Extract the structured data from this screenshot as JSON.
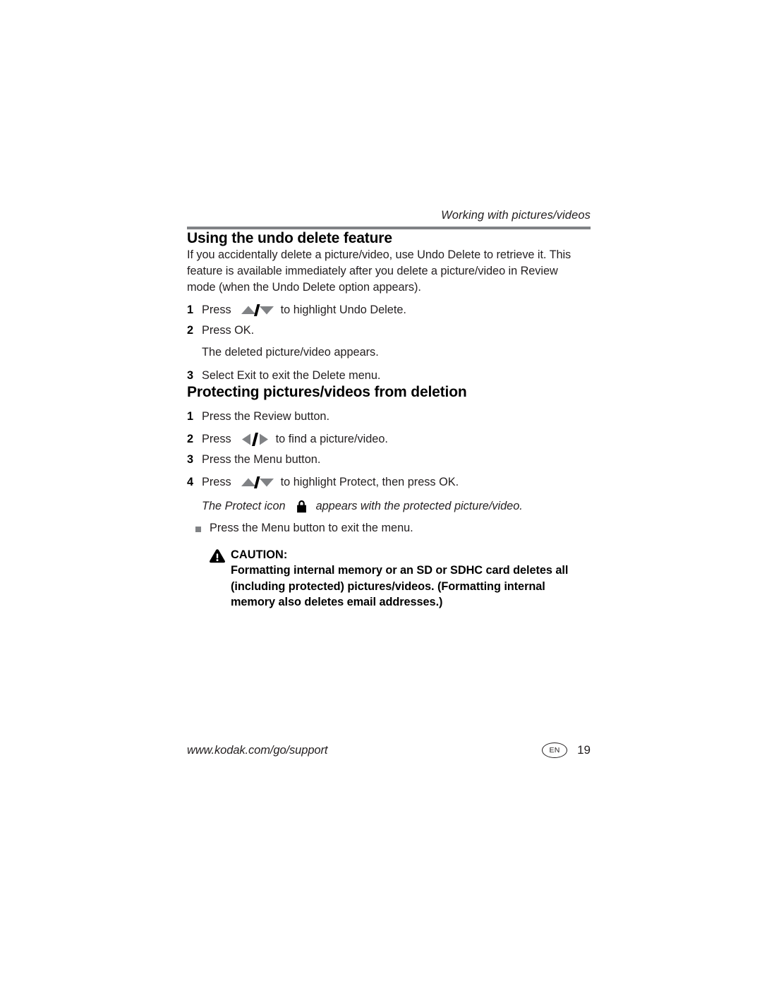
{
  "header": {
    "running_title": "Working with pictures/videos"
  },
  "sections": [
    {
      "heading": "Using the undo delete feature",
      "intro": "If you accidentally delete a picture/video, use Undo Delete to retrieve it. This feature is available immediately after you delete a picture/video in Review mode (when the Undo Delete option appears).",
      "steps": [
        {
          "num": "1",
          "pre": "Press",
          "icon": "up-down-arrows-icon",
          "post": "to highlight Undo Delete."
        },
        {
          "num": "2",
          "pre": "Press OK.",
          "icon": "",
          "post": ""
        },
        {
          "num": "",
          "note": "The deleted picture/video appears."
        },
        {
          "num": "3",
          "pre": "Select Exit to exit the Delete menu.",
          "icon": "",
          "post": ""
        }
      ]
    },
    {
      "heading": "Protecting pictures/videos from deletion",
      "steps": [
        {
          "num": "1",
          "pre": "Press the Review button.",
          "icon": "",
          "post": ""
        },
        {
          "num": "2",
          "pre": "Press",
          "icon": "left-right-arrows-icon",
          "post": "to find a picture/video."
        },
        {
          "num": "3",
          "pre": "Press the Menu button.",
          "icon": "",
          "post": ""
        },
        {
          "num": "4",
          "pre": "Press",
          "icon": "up-down-arrows-icon",
          "post": "to highlight Protect, then press OK."
        }
      ],
      "protect_note": {
        "pre": "The Protect icon",
        "icon": "padlock-icon",
        "post": "appears with the protected picture/video."
      },
      "bullets": [
        "Press the Menu button to exit the menu."
      ]
    }
  ],
  "caution": {
    "icon": "warning-triangle-icon",
    "title": "CAUTION:",
    "body": "Formatting internal memory or an SD or SDHC card deletes all (including protected) pictures/videos. (Formatting internal memory also deletes email addresses.)"
  },
  "footer": {
    "url": "www.kodak.com/go/support",
    "language": "EN",
    "page_number": "19"
  },
  "colors": {
    "rule": "#808285",
    "icon_gray": "#808285",
    "text": "#231f20"
  }
}
